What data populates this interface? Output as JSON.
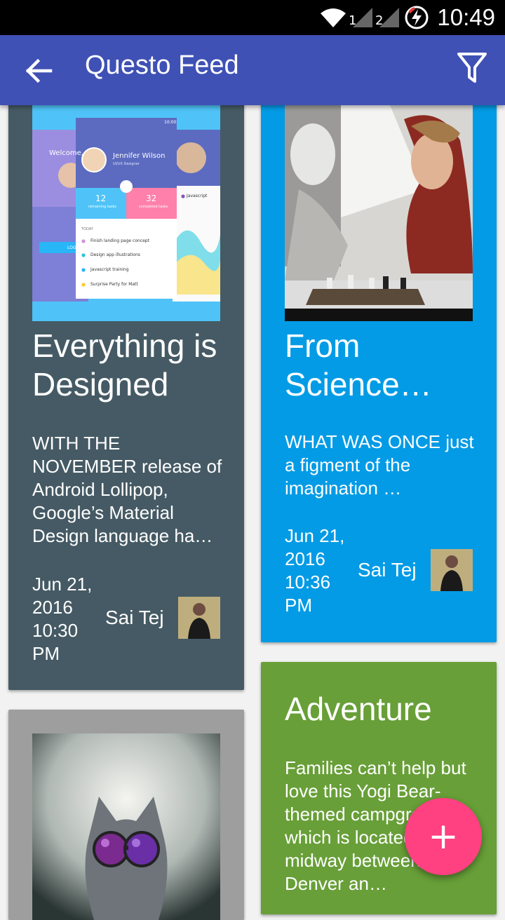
{
  "status_bar": {
    "time": "10:49",
    "sim1": "1",
    "sim2": "2"
  },
  "app_bar": {
    "title": "Questo Feed",
    "back_icon": "arrow-back-icon",
    "filter_icon": "filter-icon"
  },
  "cards": [
    {
      "title": "Everything is Designed",
      "excerpt": "WITH THE NOVEMBER release of Android Lollipop, Google’s Material Design language ha…",
      "date": "Jun 21, 2016 10:30 PM",
      "author": "Sai Tej",
      "color": "#455a64",
      "image_text": {
        "welcome": "Welcome,",
        "profile_name": "Jennifer Wilson",
        "profile_role": "UI/UX Designer",
        "remaining_count": "12",
        "remaining_label": "remaining tasks",
        "completed_count": "32",
        "completed_label": "completed tasks",
        "section": "TODAY",
        "tasks": [
          "Finish landing page concept",
          "Design app illustrations",
          "Javascript training",
          "Surprise Party for Matt"
        ],
        "chip": "Javascript",
        "phone_time": "10:00",
        "login": "LOG"
      }
    },
    {
      "title": "From Science…",
      "excerpt": "WHAT WAS ONCE just a figment of the imagination …",
      "date": "Jun 21, 2016 10:36 PM",
      "author": "Sai Tej",
      "color": "#039be5"
    },
    {
      "title": "Adventure",
      "excerpt": "Families can’t help but love this Yogi Bear-themed campground, which is located midway between Denver an…",
      "color": "#689f38"
    },
    {
      "color": "#9e9e9e"
    }
  ],
  "fab": {
    "label": "+"
  }
}
